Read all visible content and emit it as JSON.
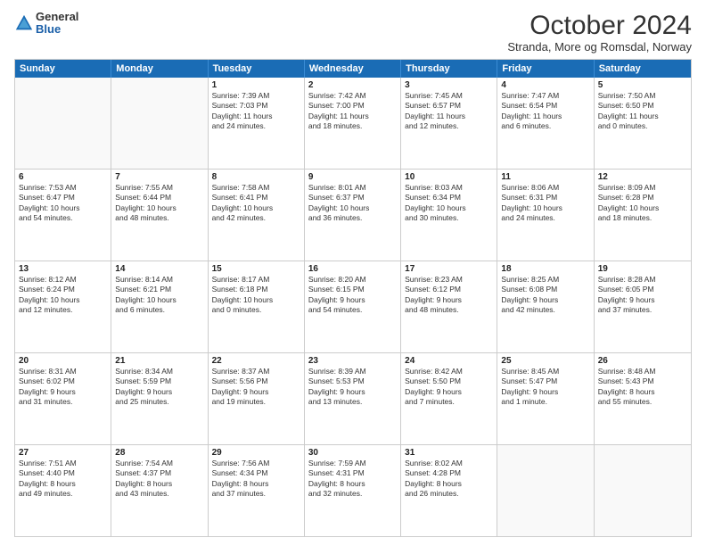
{
  "logo": {
    "general": "General",
    "blue": "Blue"
  },
  "title": "October 2024",
  "subtitle": "Stranda, More og Romsdal, Norway",
  "header_days": [
    "Sunday",
    "Monday",
    "Tuesday",
    "Wednesday",
    "Thursday",
    "Friday",
    "Saturday"
  ],
  "weeks": [
    [
      {
        "day": "",
        "lines": []
      },
      {
        "day": "",
        "lines": []
      },
      {
        "day": "1",
        "lines": [
          "Sunrise: 7:39 AM",
          "Sunset: 7:03 PM",
          "Daylight: 11 hours",
          "and 24 minutes."
        ]
      },
      {
        "day": "2",
        "lines": [
          "Sunrise: 7:42 AM",
          "Sunset: 7:00 PM",
          "Daylight: 11 hours",
          "and 18 minutes."
        ]
      },
      {
        "day": "3",
        "lines": [
          "Sunrise: 7:45 AM",
          "Sunset: 6:57 PM",
          "Daylight: 11 hours",
          "and 12 minutes."
        ]
      },
      {
        "day": "4",
        "lines": [
          "Sunrise: 7:47 AM",
          "Sunset: 6:54 PM",
          "Daylight: 11 hours",
          "and 6 minutes."
        ]
      },
      {
        "day": "5",
        "lines": [
          "Sunrise: 7:50 AM",
          "Sunset: 6:50 PM",
          "Daylight: 11 hours",
          "and 0 minutes."
        ]
      }
    ],
    [
      {
        "day": "6",
        "lines": [
          "Sunrise: 7:53 AM",
          "Sunset: 6:47 PM",
          "Daylight: 10 hours",
          "and 54 minutes."
        ]
      },
      {
        "day": "7",
        "lines": [
          "Sunrise: 7:55 AM",
          "Sunset: 6:44 PM",
          "Daylight: 10 hours",
          "and 48 minutes."
        ]
      },
      {
        "day": "8",
        "lines": [
          "Sunrise: 7:58 AM",
          "Sunset: 6:41 PM",
          "Daylight: 10 hours",
          "and 42 minutes."
        ]
      },
      {
        "day": "9",
        "lines": [
          "Sunrise: 8:01 AM",
          "Sunset: 6:37 PM",
          "Daylight: 10 hours",
          "and 36 minutes."
        ]
      },
      {
        "day": "10",
        "lines": [
          "Sunrise: 8:03 AM",
          "Sunset: 6:34 PM",
          "Daylight: 10 hours",
          "and 30 minutes."
        ]
      },
      {
        "day": "11",
        "lines": [
          "Sunrise: 8:06 AM",
          "Sunset: 6:31 PM",
          "Daylight: 10 hours",
          "and 24 minutes."
        ]
      },
      {
        "day": "12",
        "lines": [
          "Sunrise: 8:09 AM",
          "Sunset: 6:28 PM",
          "Daylight: 10 hours",
          "and 18 minutes."
        ]
      }
    ],
    [
      {
        "day": "13",
        "lines": [
          "Sunrise: 8:12 AM",
          "Sunset: 6:24 PM",
          "Daylight: 10 hours",
          "and 12 minutes."
        ]
      },
      {
        "day": "14",
        "lines": [
          "Sunrise: 8:14 AM",
          "Sunset: 6:21 PM",
          "Daylight: 10 hours",
          "and 6 minutes."
        ]
      },
      {
        "day": "15",
        "lines": [
          "Sunrise: 8:17 AM",
          "Sunset: 6:18 PM",
          "Daylight: 10 hours",
          "and 0 minutes."
        ]
      },
      {
        "day": "16",
        "lines": [
          "Sunrise: 8:20 AM",
          "Sunset: 6:15 PM",
          "Daylight: 9 hours",
          "and 54 minutes."
        ]
      },
      {
        "day": "17",
        "lines": [
          "Sunrise: 8:23 AM",
          "Sunset: 6:12 PM",
          "Daylight: 9 hours",
          "and 48 minutes."
        ]
      },
      {
        "day": "18",
        "lines": [
          "Sunrise: 8:25 AM",
          "Sunset: 6:08 PM",
          "Daylight: 9 hours",
          "and 42 minutes."
        ]
      },
      {
        "day": "19",
        "lines": [
          "Sunrise: 8:28 AM",
          "Sunset: 6:05 PM",
          "Daylight: 9 hours",
          "and 37 minutes."
        ]
      }
    ],
    [
      {
        "day": "20",
        "lines": [
          "Sunrise: 8:31 AM",
          "Sunset: 6:02 PM",
          "Daylight: 9 hours",
          "and 31 minutes."
        ]
      },
      {
        "day": "21",
        "lines": [
          "Sunrise: 8:34 AM",
          "Sunset: 5:59 PM",
          "Daylight: 9 hours",
          "and 25 minutes."
        ]
      },
      {
        "day": "22",
        "lines": [
          "Sunrise: 8:37 AM",
          "Sunset: 5:56 PM",
          "Daylight: 9 hours",
          "and 19 minutes."
        ]
      },
      {
        "day": "23",
        "lines": [
          "Sunrise: 8:39 AM",
          "Sunset: 5:53 PM",
          "Daylight: 9 hours",
          "and 13 minutes."
        ]
      },
      {
        "day": "24",
        "lines": [
          "Sunrise: 8:42 AM",
          "Sunset: 5:50 PM",
          "Daylight: 9 hours",
          "and 7 minutes."
        ]
      },
      {
        "day": "25",
        "lines": [
          "Sunrise: 8:45 AM",
          "Sunset: 5:47 PM",
          "Daylight: 9 hours",
          "and 1 minute."
        ]
      },
      {
        "day": "26",
        "lines": [
          "Sunrise: 8:48 AM",
          "Sunset: 5:43 PM",
          "Daylight: 8 hours",
          "and 55 minutes."
        ]
      }
    ],
    [
      {
        "day": "27",
        "lines": [
          "Sunrise: 7:51 AM",
          "Sunset: 4:40 PM",
          "Daylight: 8 hours",
          "and 49 minutes."
        ]
      },
      {
        "day": "28",
        "lines": [
          "Sunrise: 7:54 AM",
          "Sunset: 4:37 PM",
          "Daylight: 8 hours",
          "and 43 minutes."
        ]
      },
      {
        "day": "29",
        "lines": [
          "Sunrise: 7:56 AM",
          "Sunset: 4:34 PM",
          "Daylight: 8 hours",
          "and 37 minutes."
        ]
      },
      {
        "day": "30",
        "lines": [
          "Sunrise: 7:59 AM",
          "Sunset: 4:31 PM",
          "Daylight: 8 hours",
          "and 32 minutes."
        ]
      },
      {
        "day": "31",
        "lines": [
          "Sunrise: 8:02 AM",
          "Sunset: 4:28 PM",
          "Daylight: 8 hours",
          "and 26 minutes."
        ]
      },
      {
        "day": "",
        "lines": []
      },
      {
        "day": "",
        "lines": []
      }
    ]
  ]
}
